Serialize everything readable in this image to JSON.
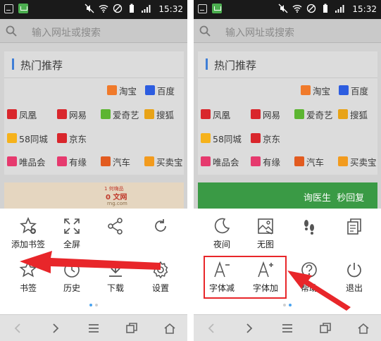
{
  "status_bar": {
    "time": "15:32"
  },
  "search": {
    "placeholder": "输入网址或搜索"
  },
  "hot": {
    "title": "热门推荐",
    "sites": [
      {
        "label": "淘宝",
        "icon": "taobao-icon",
        "color": "#f07a2b"
      },
      {
        "label": "百度",
        "icon": "baidu-icon",
        "color": "#2d5de0"
      },
      {
        "label": "凤凰",
        "icon": "ifeng-icon",
        "color": "#d9262c"
      },
      {
        "label": "网易",
        "icon": "netease-icon",
        "color": "#d9262c"
      },
      {
        "label": "爱奇艺",
        "icon": "iqiyi-icon",
        "color": "#5cb531"
      },
      {
        "label": "搜狐",
        "icon": "sohu-icon",
        "color": "#e8a317"
      },
      {
        "label": "58同城",
        "icon": "58-icon",
        "color": "#f6b21b"
      },
      {
        "label": "京东",
        "icon": "jd-icon",
        "color": "#d9262c"
      },
      {
        "label": "唯品会",
        "icon": "vip-icon",
        "color": "#e63a6e"
      },
      {
        "label": "有缘",
        "icon": "youyuan-icon",
        "color": "#e63a6e"
      },
      {
        "label": "汽车",
        "icon": "car-icon",
        "color": "#e25b20"
      },
      {
        "label": "买卖宝",
        "icon": "mmb-icon",
        "color": "#f29b1e"
      }
    ]
  },
  "left_banner": {
    "line1": "1 何嗨品",
    "line2": "0 文网",
    "line3": "rng.com"
  },
  "right_banner": {
    "text": "询医生  秒回复"
  },
  "left_menu": [
    {
      "label": "添加书签",
      "icon": "add-bookmark-icon"
    },
    {
      "label": "全屏",
      "icon": "fullscreen-icon"
    },
    {
      "label": "",
      "icon": "share-icon"
    },
    {
      "label": "",
      "icon": "refresh-icon"
    },
    {
      "label": "书签",
      "icon": "bookmark-star-icon"
    },
    {
      "label": "历史",
      "icon": "history-icon"
    },
    {
      "label": "下载",
      "icon": "download-icon"
    },
    {
      "label": "设置",
      "icon": "settings-icon"
    }
  ],
  "right_menu": [
    {
      "label": "夜间",
      "icon": "night-mode-icon"
    },
    {
      "label": "无图",
      "icon": "no-image-icon"
    },
    {
      "label": "",
      "icon": "footprint-icon"
    },
    {
      "label": "",
      "icon": "copy-icon"
    },
    {
      "label": "字体减",
      "icon": "font-decrease-icon"
    },
    {
      "label": "字体加",
      "icon": "font-increase-icon"
    },
    {
      "label": "帮助",
      "icon": "help-icon"
    },
    {
      "label": "退出",
      "icon": "exit-icon"
    }
  ],
  "annotation_color": "#e8262a",
  "accent_color": "#4aa3f0"
}
